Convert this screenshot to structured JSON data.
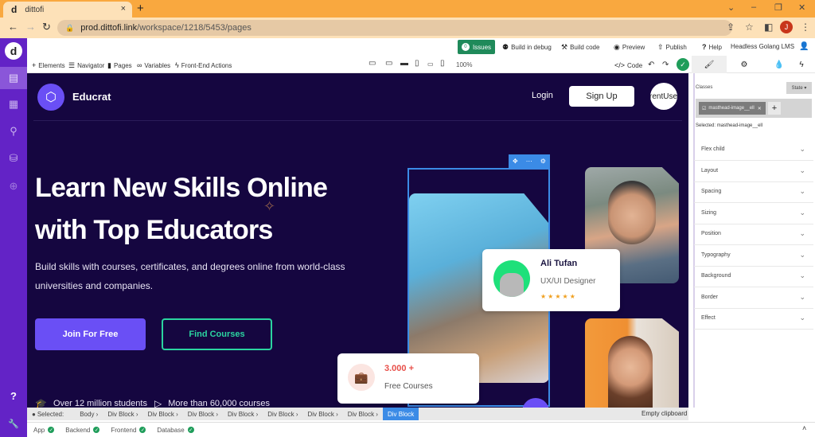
{
  "browser": {
    "tab_title": "dittofi",
    "tab_favicon": "d",
    "tab_close": "×",
    "new_tab": "+",
    "url_domain": "prod.dittofi.link",
    "url_path": "/workspace/1218/5453/pages",
    "profile_initial": "J",
    "window_controls": {
      "dropdown": "⌄",
      "minimize": "–",
      "restore": "❐",
      "close": "✕"
    }
  },
  "rail": {
    "logo": "d",
    "items": [
      {
        "name": "pages",
        "icon": "▤",
        "active": true
      },
      {
        "name": "database",
        "icon": "▦",
        "active": false
      },
      {
        "name": "endpoints",
        "icon": "⚲",
        "active": false
      },
      {
        "name": "code",
        "icon": "⛁",
        "active": false
      },
      {
        "name": "globe",
        "icon": "⊕",
        "active": false
      }
    ],
    "help_icon": "?",
    "settings_icon": "🔧"
  },
  "toolbar_top": {
    "issues_count": "0",
    "issues_label": "Issues",
    "build_debug": "Build in debug",
    "build_code": "Build code",
    "preview": "Preview",
    "publish": "Publish",
    "help": "Help",
    "project_name": "Headless Golang LMS"
  },
  "toolbar_second": {
    "elements": "Elements",
    "navigator": "Navigator",
    "pages": "Pages",
    "variables": "Variables",
    "frontend_actions": "Front-End Actions",
    "zoom": "100%",
    "code": "Code"
  },
  "site": {
    "brand": "Educrat",
    "login": "Login",
    "signup": "Sign Up",
    "current_user": "rentUse",
    "headline": "Learn New Skills Online with Top Educators",
    "subtitle": "Build skills with courses, certificates, and degrees online from world-class universities and companies.",
    "join_btn": "Join For Free",
    "find_btn": "Find Courses",
    "stat1": "Over 12 million students",
    "stat2": "More than 60,000 courses",
    "instructor_card": {
      "name": "Ali Tufan",
      "role": "UX/UI Designer",
      "rating": 5,
      "stars": "★★★★★"
    },
    "courses_card": {
      "count": "3.000 +",
      "label": "Free Courses"
    }
  },
  "right_panel": {
    "classes_label": "Classes",
    "state_btn": "State ▾",
    "class_chip": "masthead-image__ell",
    "selected_label": "Selected:",
    "selected_value": "masthead-image__ell",
    "sections": [
      "Flex child",
      "Layout",
      "Spacing",
      "Sizing",
      "Position",
      "Typography",
      "Background",
      "Border",
      "Effect"
    ]
  },
  "breadcrumb": {
    "label": "Selected:",
    "items": [
      "Body",
      "Div Block",
      "Div Block",
      "Div Block",
      "Div Block",
      "Div Block",
      "Div Block",
      "Div Block",
      "Div Block"
    ],
    "clipboard": "Empty clipboard"
  },
  "status": {
    "items": [
      "App",
      "Backend",
      "Frontend",
      "Database"
    ]
  }
}
